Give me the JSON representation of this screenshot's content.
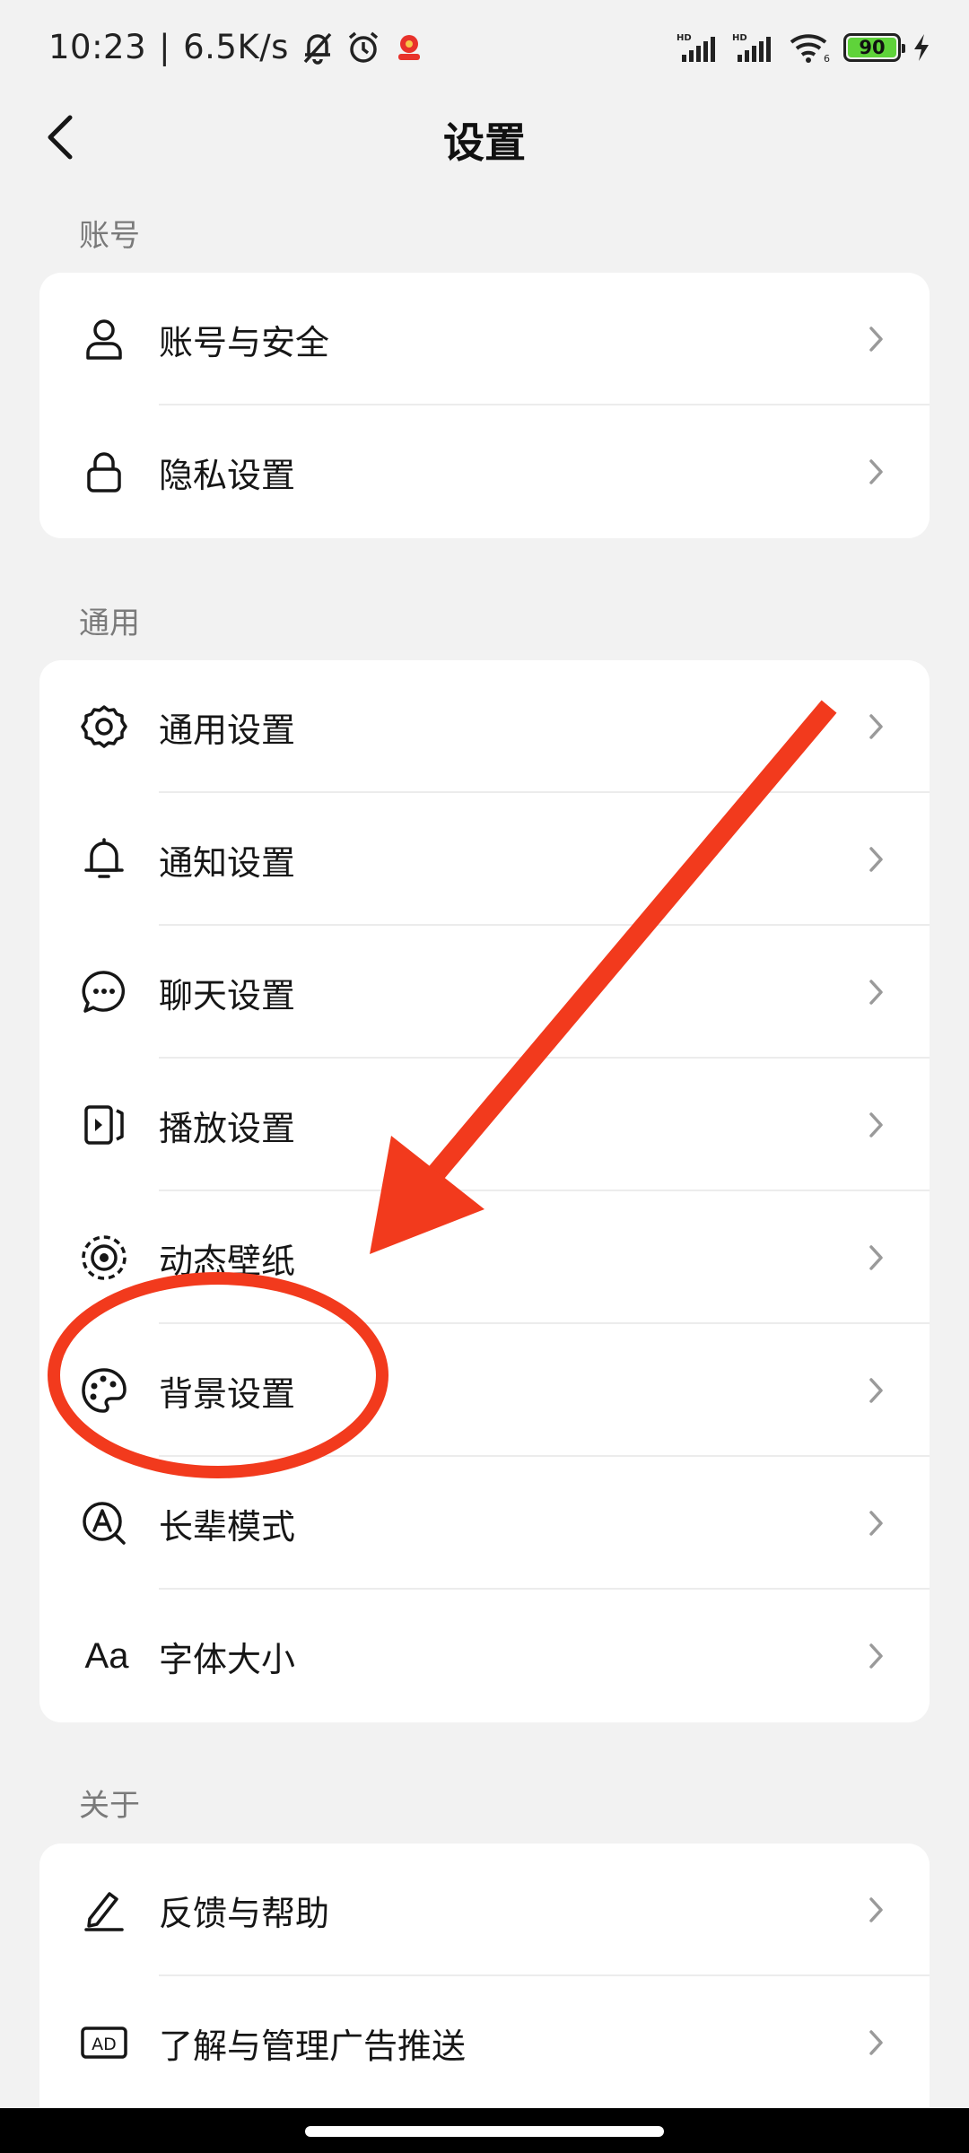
{
  "status_bar": {
    "time": "10:23",
    "speed": "6.5K/s",
    "battery": "90",
    "network_1": "HD",
    "network_2": "HD",
    "wifi_badge": "6"
  },
  "header": {
    "title": "设置"
  },
  "sections": {
    "account": {
      "label": "账号",
      "items": [
        {
          "label": "账号与安全",
          "icon": "person-icon"
        },
        {
          "label": "隐私设置",
          "icon": "lock-icon"
        }
      ]
    },
    "general": {
      "label": "通用",
      "items": [
        {
          "label": "通用设置",
          "icon": "gear-icon"
        },
        {
          "label": "通知设置",
          "icon": "bell-icon"
        },
        {
          "label": "聊天设置",
          "icon": "chat-bubble-icon"
        },
        {
          "label": "播放设置",
          "icon": "play-frame-icon"
        },
        {
          "label": "动态壁纸",
          "icon": "live-wallpaper-icon"
        },
        {
          "label": "背景设置",
          "icon": "palette-icon"
        },
        {
          "label": "长辈模式",
          "icon": "elder-mode-icon"
        },
        {
          "label": "字体大小",
          "icon": "font-size-icon",
          "icon_text": "Aa"
        }
      ]
    },
    "about": {
      "label": "关于",
      "items": [
        {
          "label": "反馈与帮助",
          "icon": "pencil-icon"
        },
        {
          "label": "了解与管理广告推送",
          "icon": "ad-icon",
          "icon_text": "AD"
        }
      ]
    }
  },
  "colors": {
    "background": "#f2f2f2",
    "card": "#ffffff",
    "annotation_red": "#f23a1d",
    "battery_green": "#5fd33a"
  }
}
